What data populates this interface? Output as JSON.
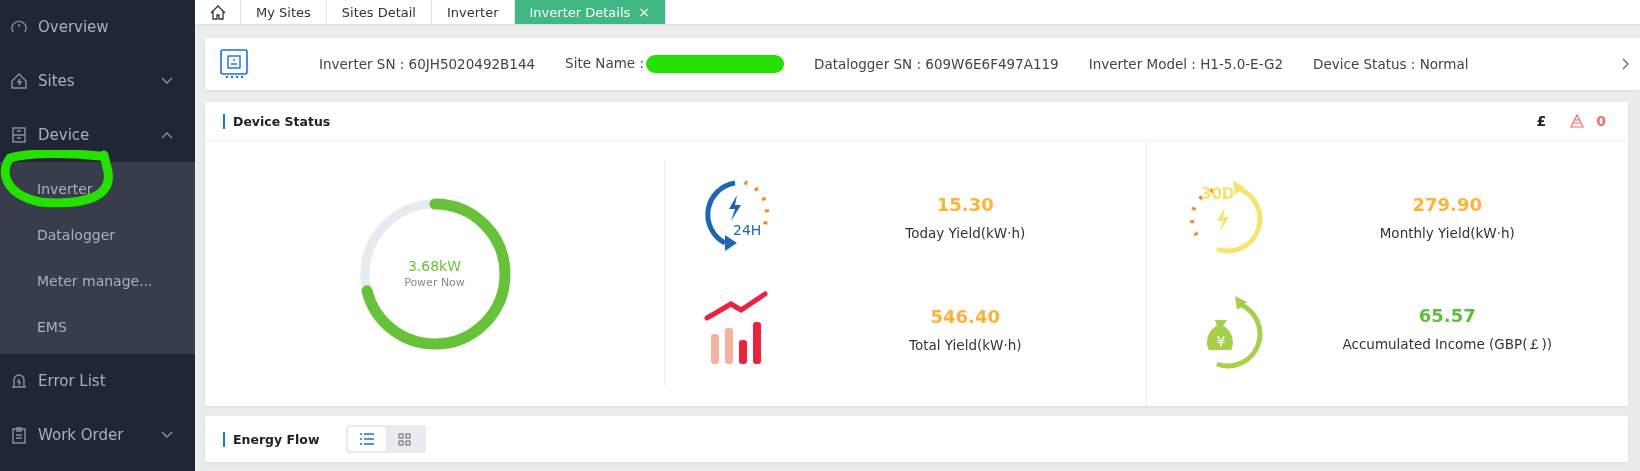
{
  "sidebar": {
    "items": [
      {
        "label": "Overview"
      },
      {
        "label": "Sites",
        "expanded": false
      },
      {
        "label": "Device",
        "expanded": true,
        "children": [
          {
            "label": "Inverter"
          },
          {
            "label": "Datalogger"
          },
          {
            "label": "Meter manage..."
          },
          {
            "label": "EMS"
          }
        ]
      },
      {
        "label": "Error List"
      },
      {
        "label": "Work Order",
        "expanded": false
      }
    ]
  },
  "tabs": [
    {
      "label": "My Sites",
      "selected": false
    },
    {
      "label": "Sites Detail",
      "selected": false
    },
    {
      "label": "Inverter",
      "selected": false
    },
    {
      "label": "Inverter Details",
      "selected": true,
      "close": "×"
    }
  ],
  "info_bar": {
    "fields": [
      {
        "label": "Inverter SN : 60JH5020492B144",
        "redacted": false
      },
      {
        "label": "Site Name :",
        "redacted": true
      },
      {
        "label": "Datalogger SN : 609W6E6F497A119",
        "redacted": false
      },
      {
        "label": "Inverter Model : H1-5.0-E-G2",
        "redacted": false
      },
      {
        "label": "Device Status : Normal",
        "redacted": false
      }
    ]
  },
  "device_status": {
    "title": "Device Status",
    "currency": "£",
    "alarm_count": "0",
    "power": {
      "value": "3.68kW",
      "label": "Power Now"
    },
    "stats": [
      {
        "kind": "today",
        "icon_text": "24H",
        "value": "15.30",
        "label": "Today Yield(kW·h)",
        "color": "#fbb438"
      },
      {
        "kind": "month",
        "icon_text": "30D",
        "value": "279.90",
        "label": "Monthly Yield(kW·h)",
        "color": "#fbb438"
      },
      {
        "kind": "total",
        "value": "546.40",
        "label": "Total Yield(kW·h)",
        "color": "#fbb438"
      },
      {
        "kind": "income",
        "icon_text": "¥",
        "value": "65.57",
        "label": "Accumulated Income (GBP(￡))",
        "color": "#5cc13a"
      }
    ]
  },
  "energy_flow": {
    "title": "Energy Flow",
    "views": [
      {
        "kind": "list",
        "selected": true
      },
      {
        "kind": "grid",
        "selected": false
      }
    ]
  }
}
